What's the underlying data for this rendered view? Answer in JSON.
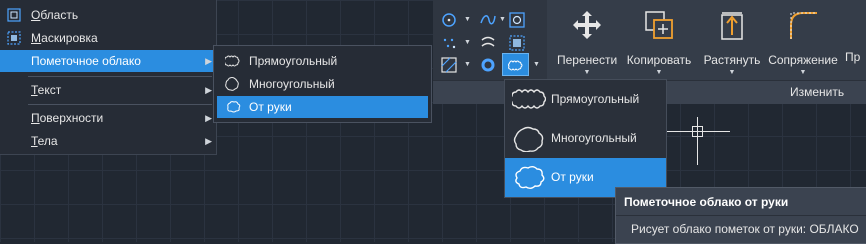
{
  "context_menu": {
    "items": [
      {
        "label": "Область",
        "mnemonic": "О",
        "rest": "бласть",
        "icon": "region-icon"
      },
      {
        "label": "Маскировка",
        "mnemonic": "М",
        "rest": "аскировка",
        "icon": "wipeout-icon"
      },
      {
        "label": "Пометочное облако",
        "icon": "none",
        "has_submenu": true,
        "selected": true
      },
      {
        "label": "Текст",
        "mnemonic": "Т",
        "rest": "екст",
        "has_submenu": true
      },
      {
        "label": "Поверхности",
        "mnemonic": "П",
        "rest": "оверхности",
        "has_submenu": true
      },
      {
        "label": "Тела",
        "mnemonic": "Т",
        "rest": "ела",
        "has_submenu": true
      }
    ],
    "submenu": [
      {
        "label": "Прямоугольный",
        "icon": "rectangular-revcloud-icon"
      },
      {
        "label": "Многоугольный",
        "icon": "polygonal-revcloud-icon"
      },
      {
        "label": "От руки",
        "icon": "freehand-revcloud-icon",
        "selected": true
      }
    ]
  },
  "ribbon": {
    "tools": [
      {
        "label": "Перенести",
        "icon": "move-icon"
      },
      {
        "label": "Копировать",
        "icon": "copy-icon"
      },
      {
        "label": "Растянуть",
        "icon": "stretch-icon"
      },
      {
        "label": "Сопряжение",
        "icon": "fillet-icon"
      },
      {
        "label": "Пр",
        "icon": "array-icon"
      }
    ],
    "panel_title": "Изменить"
  },
  "flyout": [
    {
      "label": "Прямоугольный",
      "icon": "rectangular-revcloud-icon"
    },
    {
      "label": "Многоугольный",
      "icon": "polygonal-revcloud-icon"
    },
    {
      "label": "От руки",
      "icon": "freehand-revcloud-icon",
      "selected": true
    }
  ],
  "tooltip": {
    "title": "Пометочное облако от руки",
    "description": "Рисует облако пометок от руки: ОБЛАКО"
  },
  "colors": {
    "highlight": "#2b8de0",
    "canvas": "#212832",
    "menu_bg": "#262c36",
    "ribbon_bg": "#353d49",
    "accent_orange": "#f0a030"
  }
}
